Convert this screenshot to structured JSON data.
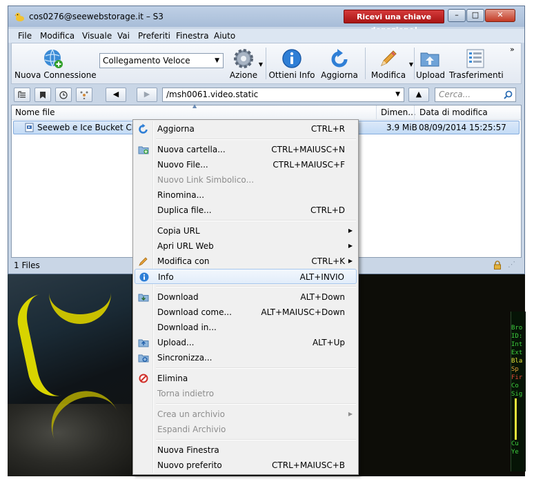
{
  "window": {
    "title": "cos0276@seewebstorage.it – S3",
    "donate_button": "Ricevi una chiave donazione!",
    "minimize": "–",
    "maximize": "□",
    "close": "✕"
  },
  "menubar": [
    "File",
    "Modifica",
    "Visuale",
    "Vai",
    "Preferiti",
    "Finestra",
    "Aiuto"
  ],
  "toolbar": {
    "new_connection": "Nuova Connessione",
    "quick_connect": "Collegamento Veloce",
    "action": "Azione",
    "get_info": "Ottieni Info",
    "refresh": "Aggiorna",
    "edit": "Modifica",
    "upload": "Upload",
    "transfers": "Trasferimenti",
    "overflow": "»"
  },
  "navbar": {
    "path": "/msh0061.video.static",
    "search_placeholder": "Cerca..."
  },
  "filelist": {
    "columns": [
      "Nome file",
      "Dimen...",
      "Data di modifica"
    ],
    "rows": [
      {
        "name": "Seeweb e Ice Bucket Chall",
        "size": "3.9 MiB",
        "modified": "08/09/2014 15:25:57"
      }
    ]
  },
  "status": {
    "count": "1 Files"
  },
  "context_menu": [
    {
      "label": "Aggiorna",
      "shortcut": "CTRL+R",
      "icon": "refresh-icon",
      "disabled": false
    },
    {
      "sep": true
    },
    {
      "label": "Nuova cartella...",
      "shortcut": "CTRL+MAIUSC+N",
      "icon": "new-folder-icon",
      "disabled": false
    },
    {
      "label": "Nuovo File...",
      "shortcut": "CTRL+MAIUSC+F",
      "disabled": false
    },
    {
      "label": "Nuovo Link Simbolico...",
      "shortcut": "",
      "disabled": true
    },
    {
      "label": "Rinomina...",
      "shortcut": "",
      "disabled": false
    },
    {
      "label": "Duplica file...",
      "shortcut": "CTRL+D",
      "disabled": false
    },
    {
      "sep": true
    },
    {
      "label": "Copia URL",
      "shortcut": "",
      "submenu": true,
      "disabled": false
    },
    {
      "label": "Apri URL Web",
      "shortcut": "",
      "submenu": true,
      "disabled": false
    },
    {
      "label": "Modifica con",
      "shortcut": "CTRL+K",
      "submenu": true,
      "icon": "pencil-icon",
      "disabled": false
    },
    {
      "label": "Info",
      "shortcut": "ALT+INVIO",
      "icon": "info-icon",
      "disabled": false,
      "highlighted": true
    },
    {
      "sep": true
    },
    {
      "label": "Download",
      "shortcut": "ALT+Down",
      "icon": "download-icon",
      "disabled": false
    },
    {
      "label": "Download come...",
      "shortcut": "ALT+MAIUSC+Down",
      "disabled": false
    },
    {
      "label": "Download in...",
      "shortcut": "",
      "disabled": false
    },
    {
      "label": "Upload...",
      "shortcut": "ALT+Up",
      "icon": "upload-icon",
      "disabled": false
    },
    {
      "label": "Sincronizza...",
      "shortcut": "",
      "icon": "sync-icon",
      "disabled": false
    },
    {
      "sep": true
    },
    {
      "label": "Elimina",
      "shortcut": "",
      "icon": "delete-icon",
      "disabled": false
    },
    {
      "label": "Torna indietro",
      "shortcut": "",
      "disabled": true
    },
    {
      "sep": true
    },
    {
      "label": "Crea un archivio",
      "shortcut": "",
      "submenu": true,
      "disabled": true
    },
    {
      "label": "Espandi Archivio",
      "shortcut": "",
      "disabled": true
    },
    {
      "sep": true
    },
    {
      "label": "Nuova Finestra",
      "shortcut": "",
      "disabled": false
    },
    {
      "label": "Nuovo preferito",
      "shortcut": "CTRL+MAIUSC+B",
      "disabled": false
    }
  ],
  "side_panel": {
    "lines": [
      "Bro",
      "ID:",
      "Int",
      "Ext",
      "Bla",
      "Sp",
      "Fir",
      "Co",
      "Sig"
    ],
    "colors": [
      "#3fd03f",
      "#3fd03f",
      "#3fd03f",
      "#3fd03f",
      "#e6e63a",
      "#e6a23a",
      "#e04a3a",
      "#3fd03f",
      "#3fd03f"
    ],
    "footer": [
      "Cu",
      "Ye"
    ]
  }
}
